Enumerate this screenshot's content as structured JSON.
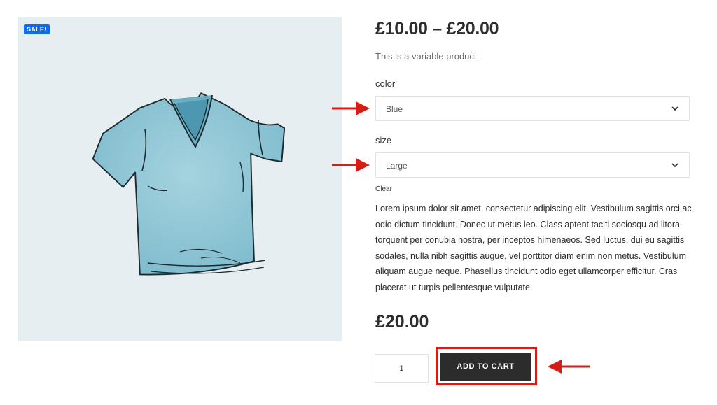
{
  "product": {
    "badge": "SALE!",
    "price_range": "£10.00 – £20.00",
    "short_description": "This is a variable product.",
    "long_description": "Lorem ipsum dolor sit amet, consectetur adipiscing elit. Vestibulum sagittis orci ac odio dictum tincidunt. Donec ut metus leo. Class aptent taciti sociosqu ad litora torquent per conubia nostra, per inceptos himenaeos. Sed luctus, dui eu sagittis sodales, nulla nibh sagittis augue, vel porttitor diam enim non metus. Vestibulum aliquam augue neque. Phasellus tincidunt odio eget ullamcorper efficitur. Cras placerat ut turpis pellentesque vulputate.",
    "selected_price": "£20.00"
  },
  "attributes": {
    "color": {
      "label": "color",
      "value": "Blue"
    },
    "size": {
      "label": "size",
      "value": "Large"
    }
  },
  "clear_label": "Clear",
  "cart": {
    "quantity": "1",
    "button_label": "ADD TO CART"
  },
  "colors": {
    "badge": "#0a6cf5",
    "button": "#2c2c2c",
    "annotation": "#d21e17",
    "image_bg": "#e7eef2",
    "shirt": "#8fc6d6"
  },
  "icons": {
    "select_chevron": "chevron-down-icon",
    "annotation_arrow": "arrow-icon"
  }
}
